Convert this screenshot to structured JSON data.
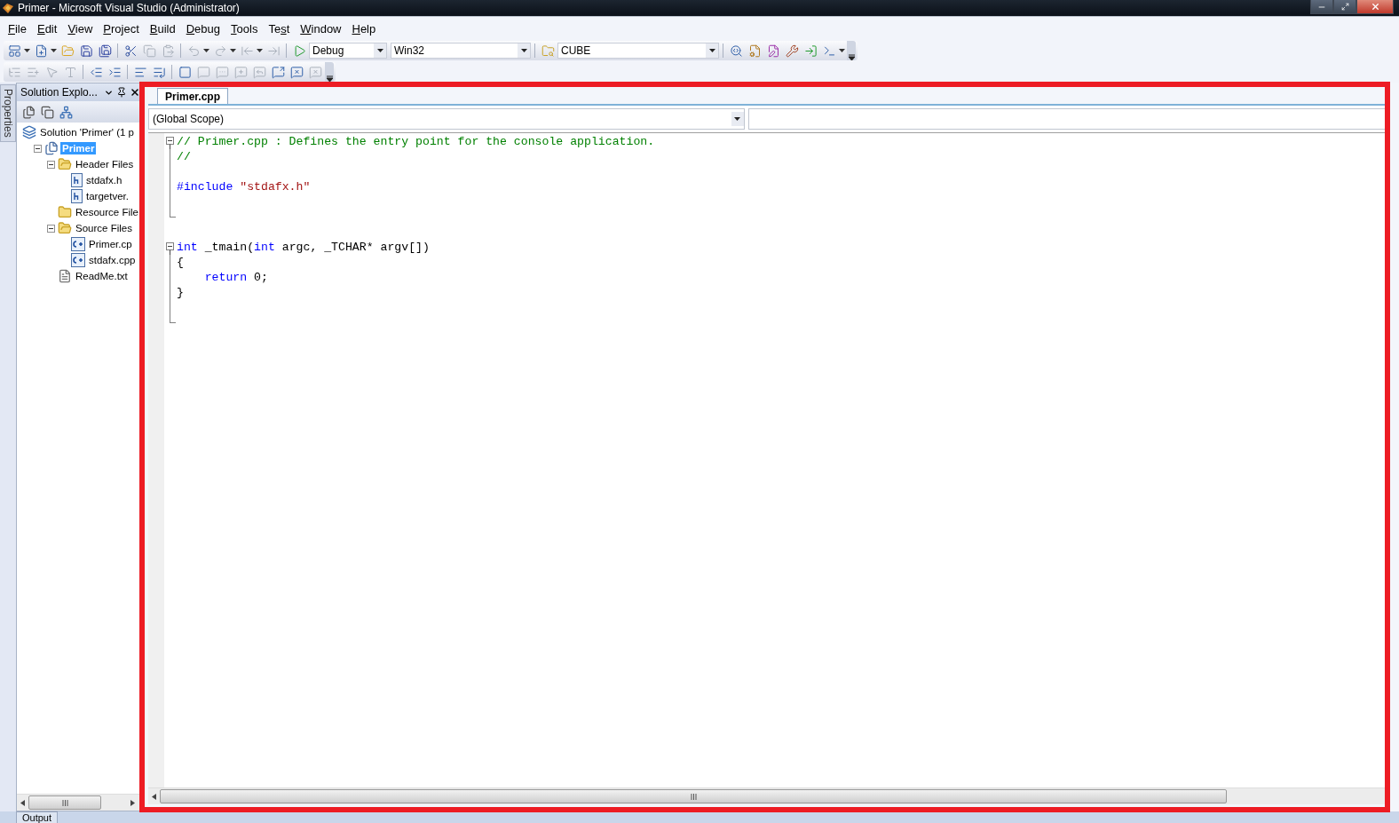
{
  "window": {
    "title": "Primer - Microsoft Visual Studio (Administrator)"
  },
  "menu": [
    {
      "key": "F",
      "after": "ile"
    },
    {
      "key": "E",
      "after": "dit"
    },
    {
      "key": "V",
      "after": "iew"
    },
    {
      "key": "P",
      "after": "roject"
    },
    {
      "key": "B",
      "after": "uild"
    },
    {
      "key": "D",
      "after": "ebug"
    },
    {
      "key": "T",
      "after": "ools"
    },
    {
      "before": "Te",
      "key": "s",
      "after": "t"
    },
    {
      "key": "W",
      "after": "indow"
    },
    {
      "key": "H",
      "after": "elp"
    }
  ],
  "toolbar_1": {
    "buttons_left": [
      {
        "disabled": false
      },
      {
        "disabled": false
      },
      {
        "disabled": false
      },
      {
        "disabled": false
      },
      {
        "disabled": false
      },
      {
        "disabled": false
      },
      {
        "disabled": true
      },
      {
        "disabled": true
      },
      {
        "disabled": true
      },
      {
        "disabled": true
      },
      {
        "disabled": true
      },
      {
        "disabled": true
      },
      {
        "disabled": false
      }
    ],
    "configuration": "Debug",
    "platform": "Win32",
    "search_value": "CUBE",
    "buttons_right": [
      {
        "disabled": false
      },
      {
        "disabled": false
      },
      {
        "disabled": false
      },
      {
        "disabled": false
      },
      {
        "disabled": false
      },
      {
        "disabled": false
      }
    ]
  },
  "toolbar_2": {
    "buttons": [
      {
        "disabled": true
      },
      {
        "disabled": true
      },
      {
        "disabled": true
      },
      {
        "disabled": true
      },
      {
        "disabled": false
      },
      {
        "disabled": false
      },
      {
        "disabled": false
      },
      {
        "disabled": false
      },
      {
        "disabled": false
      },
      {
        "disabled": true
      },
      {
        "disabled": true
      },
      {
        "disabled": true
      },
      {
        "disabled": true
      },
      {
        "disabled": false
      },
      {
        "disabled": false
      },
      {
        "disabled": true
      }
    ]
  },
  "side_tab": {
    "label": "Properties"
  },
  "solution_explorer": {
    "title": "Solution Explo...",
    "tree": [
      {
        "label": "Solution 'Primer' (1 p",
        "kind": "solution",
        "selected": false,
        "children": [
          {
            "label": "Primer",
            "kind": "project",
            "selected": true,
            "expanded": true,
            "children": [
              {
                "label": "Header Files",
                "kind": "folder",
                "selected": false,
                "expanded": true,
                "children": [
                  {
                    "label": "stdafx.h",
                    "kind": "header",
                    "selected": false
                  },
                  {
                    "label": "targetver.",
                    "kind": "header",
                    "selected": false
                  }
                ]
              },
              {
                "label": "Resource File",
                "kind": "folder",
                "selected": false,
                "expanded": false
              },
              {
                "label": "Source Files",
                "kind": "folder",
                "selected": false,
                "expanded": true,
                "children": [
                  {
                    "label": "Primer.cp",
                    "kind": "cpp",
                    "selected": false
                  },
                  {
                    "label": "stdafx.cpp",
                    "kind": "cpp",
                    "selected": false
                  }
                ]
              },
              {
                "label": "ReadMe.txt",
                "kind": "text",
                "selected": false
              }
            ]
          }
        ]
      }
    ]
  },
  "editor": {
    "tabs": [
      {
        "label": "Primer.cpp",
        "selected": true
      }
    ],
    "scope": "(Global Scope)",
    "lines": [
      {
        "kind": "fold_start",
        "tokens": [
          {
            "kind": "comment",
            "text": "// Primer.cpp : Defines the entry point for the console application."
          }
        ]
      },
      {
        "kind": "fold_body",
        "tokens": [
          {
            "kind": "comment",
            "text": "//"
          }
        ]
      },
      {
        "kind": "fold_body"
      },
      {
        "kind": "fold_body",
        "tokens": [
          {
            "kind": "keyword",
            "text": "#include"
          },
          {
            "kind": "string",
            "text": " \"stdafx.h\""
          }
        ]
      },
      {
        "kind": "fold_body"
      },
      {
        "kind": "fold_end"
      },
      {
        "kind": "plain"
      },
      {
        "kind": "fold_start",
        "tokens": [
          {
            "kind": "keyword",
            "text": "int"
          },
          {
            "kind": "plain",
            "text": " _tmain("
          },
          {
            "kind": "keyword",
            "text": "int"
          },
          {
            "kind": "plain",
            "text": " argc, _TCHAR* argv[])"
          }
        ]
      },
      {
        "kind": "fold_body",
        "tokens": [
          {
            "kind": "plain",
            "text": "{"
          }
        ]
      },
      {
        "kind": "fold_body",
        "tokens": [
          {
            "kind": "keyword",
            "text": "    return"
          },
          {
            "kind": "plain",
            "text": " 0;"
          }
        ]
      },
      {
        "kind": "fold_body",
        "tokens": [
          {
            "kind": "plain",
            "text": "}"
          }
        ]
      },
      {
        "kind": "fold_body"
      },
      {
        "kind": "fold_end"
      }
    ]
  },
  "output_tab": {
    "label": "Output"
  }
}
